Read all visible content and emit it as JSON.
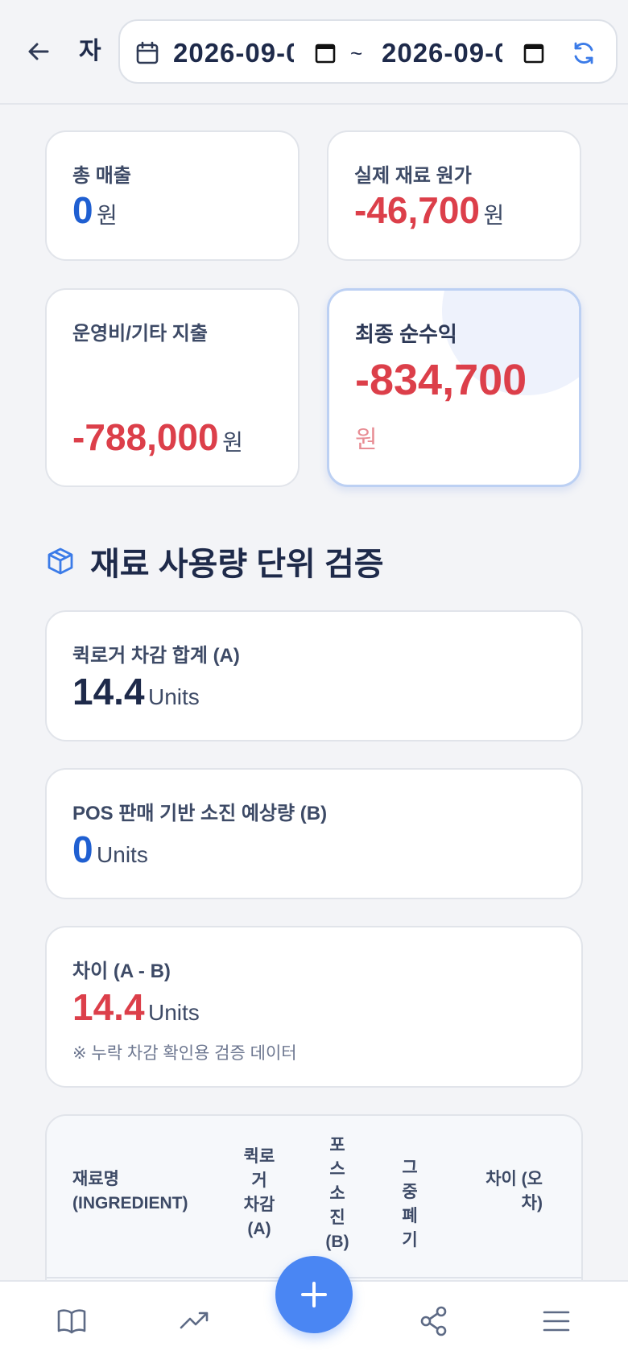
{
  "header": {
    "title": "자",
    "date_from": "2026-09-0",
    "date_to": "2026-09-0",
    "separator": "~"
  },
  "summary": {
    "sales": {
      "label": "총 매출",
      "value": "0",
      "unit": "원"
    },
    "material_cost": {
      "label": "실제 재료 원가",
      "value": "-46,700",
      "unit": "원"
    },
    "opex": {
      "label": "운영비/기타 지출",
      "value": "-788,000",
      "unit": "원"
    },
    "net_profit": {
      "label": "최종 순수익",
      "value": "-834,700",
      "unit": "원"
    }
  },
  "verification": {
    "title": "재료 사용량 단위 검증",
    "quicklog_total": {
      "label": "퀵로거 차감 합계 (A)",
      "value": "14.4",
      "unit": "Units"
    },
    "pos_estimate": {
      "label": "POS 판매 기반 소진 예상량 (B)",
      "value": "0",
      "unit": "Units"
    },
    "difference": {
      "label": "차이 (A - B)",
      "value": "14.4",
      "unit": "Units",
      "note": "※ 누락 차감 확인용 검증 데이터"
    }
  },
  "table": {
    "headers": {
      "name_1": "재료명",
      "name_2": "(INGREDIENT)",
      "a": [
        "퀵로",
        "거",
        "차감",
        "(A)"
      ],
      "b": [
        "포",
        "스",
        "소",
        "진",
        "(B)"
      ],
      "waste": [
        "그",
        "중",
        "폐",
        "기"
      ],
      "diff": [
        "차이 (오",
        "차)"
      ]
    }
  },
  "colors": {
    "accent": "#4a86f3",
    "positive_blue": "#1f5fd1",
    "negative_red": "#dc3f4a",
    "text_navy": "#1e2a4a",
    "background": "#f3f4f7"
  },
  "icons": {
    "back": "arrow-left-icon",
    "calendar": "calendar-icon",
    "refresh": "refresh-icon",
    "section": "cube-icon",
    "nav": [
      "book-icon",
      "trending-up-icon",
      "plus-icon",
      "share-icon",
      "menu-icon"
    ]
  }
}
